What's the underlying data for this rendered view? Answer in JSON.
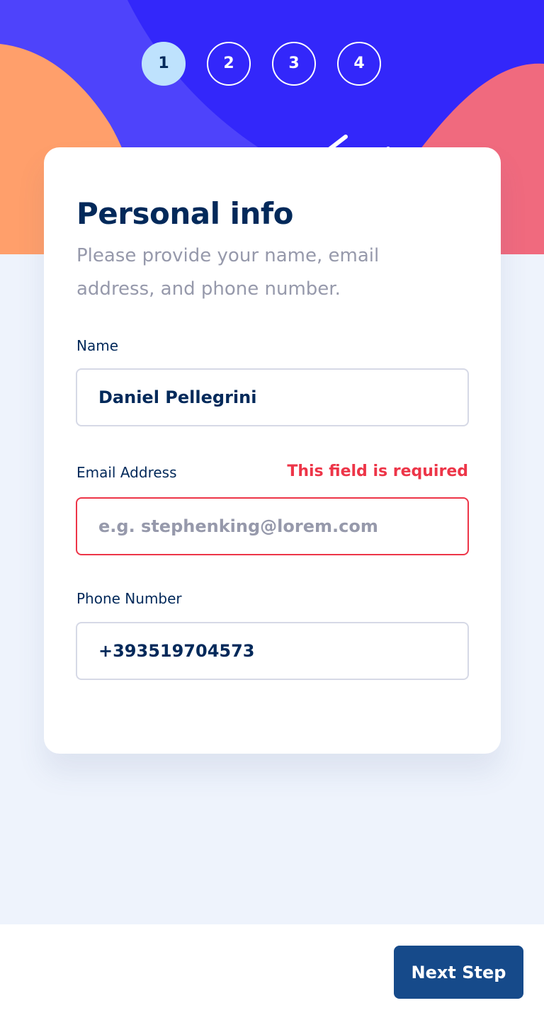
{
  "steps": [
    "1",
    "2",
    "3",
    "4"
  ],
  "active_step": 1,
  "colors": {
    "hero_blue": "#3327fa",
    "accent_orange": "#ff9f6b",
    "accent_pink": "#f06a7e",
    "marine_blue": "#02295a",
    "error_red": "#ed3548",
    "button_blue": "#164a8a",
    "step_active": "#bee2fd"
  },
  "form": {
    "title": "Personal info",
    "subtitle": "Please provide your name, email address, and phone number.",
    "fields": {
      "name": {
        "label": "Name",
        "value": "Daniel Pellegrini"
      },
      "email": {
        "label": "Email Address",
        "error": "This field is required",
        "value": "",
        "placeholder": "e.g. stephenking@lorem.com"
      },
      "phone": {
        "label": "Phone Number",
        "value": "+393519704573"
      }
    }
  },
  "footer": {
    "next_label": "Next Step"
  }
}
